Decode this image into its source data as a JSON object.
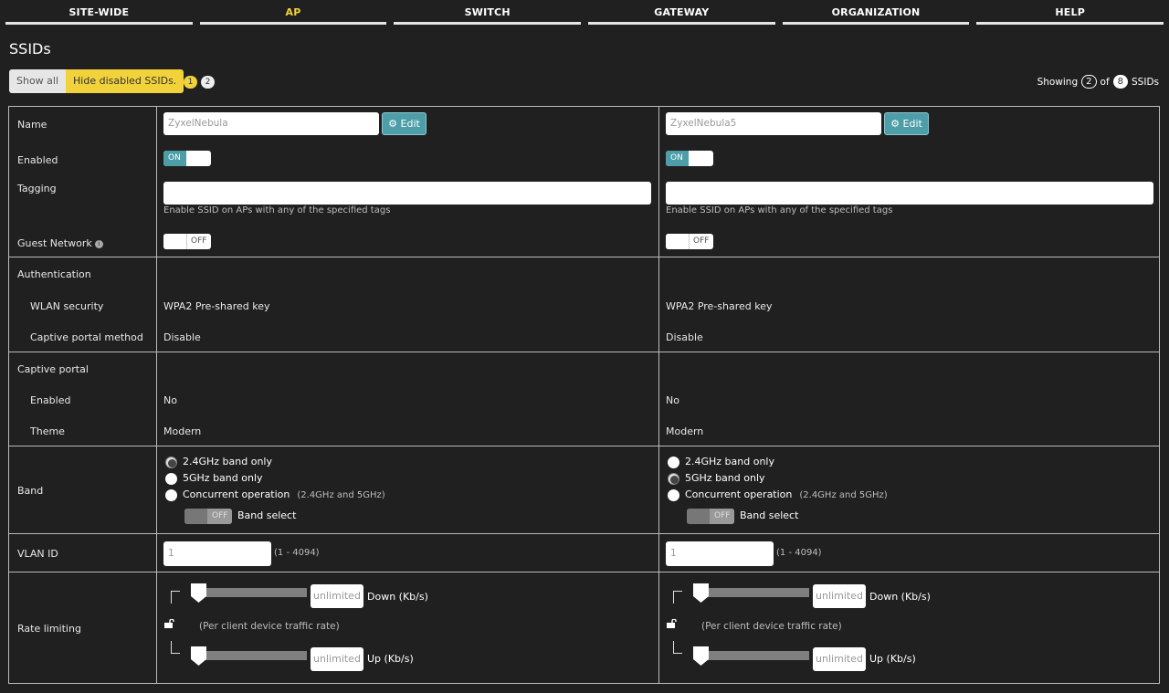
{
  "nav": {
    "tabs": [
      {
        "label": "SITE-WIDE"
      },
      {
        "label": "AP"
      },
      {
        "label": "SWITCH"
      },
      {
        "label": "GATEWAY"
      },
      {
        "label": "ORGANIZATION"
      },
      {
        "label": "HELP"
      }
    ],
    "active_tab": "AP"
  },
  "page_title": "SSIDs",
  "filter": {
    "show_all": "Show all",
    "hide_disabled": "Hide disabled SSIDs."
  },
  "pagination": {
    "current": "1",
    "other": "2"
  },
  "showing": {
    "prefix": "Showing",
    "count": "2",
    "of": "of",
    "total": "8",
    "suffix": "SSIDs"
  },
  "labels": {
    "name": "Name",
    "enabled": "Enabled",
    "tagging": "Tagging",
    "guest_network": "Guest Network",
    "authentication": "Authentication",
    "wlan_security": "WLAN security",
    "captive_portal_method": "Captive portal method",
    "captive_portal": "Captive portal",
    "cp_enabled": "Enabled",
    "theme": "Theme",
    "band": "Band",
    "vlan_id": "VLAN ID",
    "rate_limiting": "Rate limiting"
  },
  "common": {
    "edit": "Edit",
    "on": "ON",
    "off": "OFF",
    "tag_hint": "Enable SSID on APs with any of the specified tags",
    "band_24": "2.4GHz band only",
    "band_5": "5GHz band only",
    "band_concurrent": "Concurrent operation",
    "band_concurrent_hint": "(2.4GHz and 5GHz)",
    "band_select": "Band select",
    "vlan_range": "(1 - 4094)",
    "unlimited": "unlimited",
    "down": "Down (Kb/s)",
    "up": "Up (Kb/s)",
    "per_client": "(Per client device traffic rate)"
  },
  "ssids": [
    {
      "name": "ZyxelNebula",
      "enabled": true,
      "guest_network": false,
      "wlan_security": "WPA2 Pre-shared key",
      "captive_portal_method": "Disable",
      "cp_enabled": "No",
      "theme": "Modern",
      "band_selected": "2.4GHz band only",
      "band_select": false,
      "vlan_id": "1"
    },
    {
      "name": "ZyxelNebula5",
      "enabled": true,
      "guest_network": false,
      "wlan_security": "WPA2 Pre-shared key",
      "captive_portal_method": "Disable",
      "cp_enabled": "No",
      "theme": "Modern",
      "band_selected": "5GHz band only",
      "band_select": false,
      "vlan_id": "1"
    }
  ],
  "colors": {
    "accent_yellow": "#f2d23a",
    "accent_teal": "#4d9ea9",
    "background": "#202020"
  }
}
